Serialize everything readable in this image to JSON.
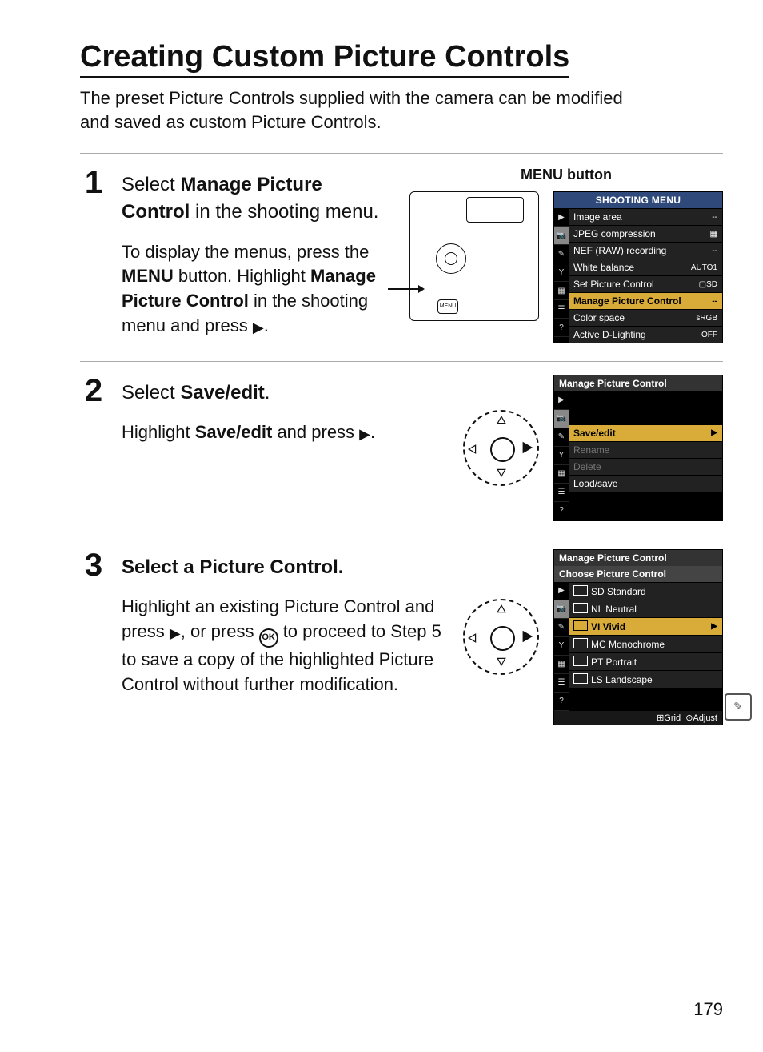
{
  "title": "Creating Custom Picture Controls",
  "intro": "The preset Picture Controls supplied with the camera can be modified and saved as custom Picture Controls.",
  "page_number": "179",
  "menu_btn_label": "MENU button",
  "menu_word": "MENU",
  "ok_label": "OK",
  "steps": {
    "1": {
      "num": "1",
      "head_pre": "Select ",
      "head_bold": "Manage Picture Control",
      "head_post": " in the shooting menu.",
      "para_a": "To display the menus, press the ",
      "para_b": " button.  Highlight ",
      "para_c": "Manage Picture Control",
      "para_d": " in the shooting menu and press ",
      "para_e": "."
    },
    "2": {
      "num": "2",
      "head_pre": "Select ",
      "head_bold": "Save/edit",
      "head_post": ".",
      "para_a": "Highlight ",
      "para_b": "Save/edit",
      "para_c": " and press ",
      "para_d": "."
    },
    "3": {
      "num": "3",
      "head": "Select a Picture Control.",
      "para_a": "Highlight an existing Picture Control and press ",
      "para_b": ", or press ",
      "para_c": " to proceed to Step 5 to save a copy of the highlighted Picture Control without further modification."
    }
  },
  "lcd1": {
    "title": "SHOOTING MENU",
    "rows": [
      {
        "label": "Image area",
        "val": "--"
      },
      {
        "label": "JPEG compression",
        "val": "▦"
      },
      {
        "label": "NEF (RAW) recording",
        "val": "--"
      },
      {
        "label": "White balance",
        "val": "AUTO1"
      },
      {
        "label": "Set Picture Control",
        "val": "▢SD"
      },
      {
        "label": "Manage Picture Control",
        "val": "--",
        "sel": true
      },
      {
        "label": "Color space",
        "val": "sRGB"
      },
      {
        "label": "Active D-Lighting",
        "val": "OFF"
      }
    ]
  },
  "lcd2": {
    "title": "Manage Picture Control",
    "rows": [
      {
        "label": "Save/edit",
        "val": "▶",
        "sel": true
      },
      {
        "label": "Rename",
        "dim": true
      },
      {
        "label": "Delete",
        "dim": true
      },
      {
        "label": "Load/save"
      }
    ]
  },
  "lcd3": {
    "title": "Manage Picture Control",
    "subtitle": "Choose Picture Control",
    "rows": [
      {
        "code": "SD",
        "label": "Standard"
      },
      {
        "code": "NL",
        "label": "Neutral"
      },
      {
        "code": "VI",
        "label": "Vivid",
        "val": "▶",
        "sel": true
      },
      {
        "code": "MC",
        "label": "Monochrome"
      },
      {
        "code": "PT",
        "label": "Portrait"
      },
      {
        "code": "LS",
        "label": "Landscape"
      }
    ],
    "footer_a": "⊞Grid",
    "footer_b": "⊙Adjust"
  },
  "side_icons": [
    "▶",
    "📷",
    "✎",
    "Y",
    "▦",
    "☰",
    "?"
  ],
  "side_glyph": "✎"
}
